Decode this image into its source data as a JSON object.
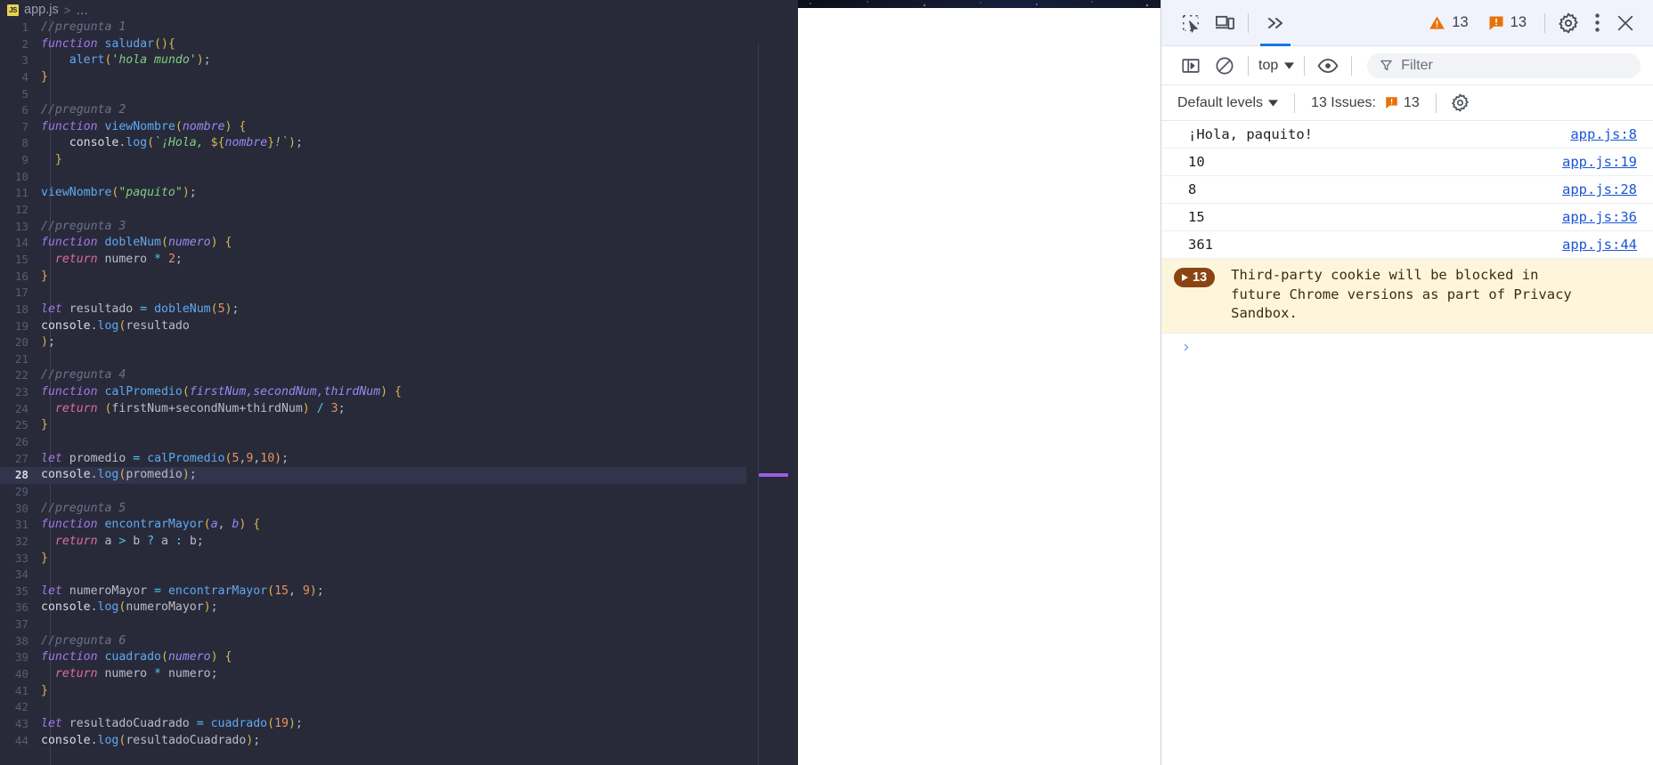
{
  "editor": {
    "breadcrumb": {
      "file_icon": "js-file-icon",
      "filename": "app.js",
      "separator": ">",
      "ellipsis": "…"
    },
    "active_line": 28,
    "lines": [
      {
        "n": 1,
        "tokens": [
          {
            "t": "//pregunta 1",
            "c": "t-com"
          }
        ]
      },
      {
        "n": 2,
        "tokens": [
          {
            "t": "function ",
            "c": "t-kw"
          },
          {
            "t": "saludar",
            "c": "t-fn"
          },
          {
            "t": "(){",
            "c": "t-pun"
          }
        ]
      },
      {
        "n": 3,
        "tokens": [
          {
            "t": "    ",
            "c": "t-pln"
          },
          {
            "t": "alert",
            "c": "t-fn"
          },
          {
            "t": "(",
            "c": "t-pun"
          },
          {
            "t": "'hola mundo'",
            "c": "t-str"
          },
          {
            "t": ")",
            "c": "t-pun"
          },
          {
            "t": ";",
            "c": "t-pln"
          }
        ]
      },
      {
        "n": 4,
        "tokens": [
          {
            "t": "}",
            "c": "t-pun"
          }
        ]
      },
      {
        "n": 5,
        "tokens": []
      },
      {
        "n": 6,
        "tokens": [
          {
            "t": "//pregunta 2",
            "c": "t-com"
          }
        ]
      },
      {
        "n": 7,
        "tokens": [
          {
            "t": "function ",
            "c": "t-kw"
          },
          {
            "t": "viewNombre",
            "c": "t-fn"
          },
          {
            "t": "(",
            "c": "t-pun"
          },
          {
            "t": "nombre",
            "c": "t-par"
          },
          {
            "t": ") {",
            "c": "t-pun"
          }
        ]
      },
      {
        "n": 8,
        "tokens": [
          {
            "t": "    ",
            "c": "t-pln"
          },
          {
            "t": "console",
            "c": "t-obj"
          },
          {
            "t": ".",
            "c": "t-pln"
          },
          {
            "t": "log",
            "c": "t-prop"
          },
          {
            "t": "(",
            "c": "t-pun"
          },
          {
            "t": "`¡Hola, ",
            "c": "t-str"
          },
          {
            "t": "${",
            "c": "t-pun"
          },
          {
            "t": "nombre",
            "c": "t-par"
          },
          {
            "t": "}",
            "c": "t-pun"
          },
          {
            "t": "!`",
            "c": "t-str"
          },
          {
            "t": ")",
            "c": "t-pun"
          },
          {
            "t": ";",
            "c": "t-pln"
          }
        ]
      },
      {
        "n": 9,
        "tokens": [
          {
            "t": "  }",
            "c": "t-pun"
          }
        ]
      },
      {
        "n": 10,
        "tokens": []
      },
      {
        "n": 11,
        "tokens": [
          {
            "t": "viewNombre",
            "c": "t-fn"
          },
          {
            "t": "(",
            "c": "t-pun"
          },
          {
            "t": "\"paquito\"",
            "c": "t-str"
          },
          {
            "t": ")",
            "c": "t-pun"
          },
          {
            "t": ";",
            "c": "t-pln"
          }
        ]
      },
      {
        "n": 12,
        "tokens": []
      },
      {
        "n": 13,
        "tokens": [
          {
            "t": "//pregunta 3",
            "c": "t-com"
          }
        ]
      },
      {
        "n": 14,
        "tokens": [
          {
            "t": "function ",
            "c": "t-kw"
          },
          {
            "t": "dobleNum",
            "c": "t-fn"
          },
          {
            "t": "(",
            "c": "t-pun"
          },
          {
            "t": "numero",
            "c": "t-par"
          },
          {
            "t": ") {",
            "c": "t-pun"
          }
        ]
      },
      {
        "n": 15,
        "tokens": [
          {
            "t": "  ",
            "c": "t-pln"
          },
          {
            "t": "return ",
            "c": "t-kw2"
          },
          {
            "t": "numero ",
            "c": "t-pln"
          },
          {
            "t": "*",
            "c": "t-op"
          },
          {
            "t": " ",
            "c": "t-pln"
          },
          {
            "t": "2",
            "c": "t-num"
          },
          {
            "t": ";",
            "c": "t-pln"
          }
        ]
      },
      {
        "n": 16,
        "tokens": [
          {
            "t": "}",
            "c": "t-pun"
          }
        ]
      },
      {
        "n": 17,
        "tokens": []
      },
      {
        "n": 18,
        "tokens": [
          {
            "t": "let ",
            "c": "t-kw"
          },
          {
            "t": "resultado ",
            "c": "t-pln"
          },
          {
            "t": "=",
            "c": "t-eq"
          },
          {
            "t": " ",
            "c": "t-pln"
          },
          {
            "t": "dobleNum",
            "c": "t-fn"
          },
          {
            "t": "(",
            "c": "t-pun"
          },
          {
            "t": "5",
            "c": "t-num"
          },
          {
            "t": ")",
            "c": "t-pun"
          },
          {
            "t": ";",
            "c": "t-pln"
          }
        ]
      },
      {
        "n": 19,
        "tokens": [
          {
            "t": "console",
            "c": "t-obj"
          },
          {
            "t": ".",
            "c": "t-pln"
          },
          {
            "t": "log",
            "c": "t-prop"
          },
          {
            "t": "(",
            "c": "t-pun"
          },
          {
            "t": "resultado",
            "c": "t-pln"
          }
        ]
      },
      {
        "n": 20,
        "tokens": [
          {
            "t": ")",
            "c": "t-pun"
          },
          {
            "t": ";",
            "c": "t-pln"
          }
        ]
      },
      {
        "n": 21,
        "tokens": []
      },
      {
        "n": 22,
        "tokens": [
          {
            "t": "//pregunta 4",
            "c": "t-com"
          }
        ]
      },
      {
        "n": 23,
        "tokens": [
          {
            "t": "function ",
            "c": "t-kw"
          },
          {
            "t": "calPromedio",
            "c": "t-fn"
          },
          {
            "t": "(",
            "c": "t-pun"
          },
          {
            "t": "firstNum,secondNum,thirdNum",
            "c": "t-par"
          },
          {
            "t": ") {",
            "c": "t-pun"
          }
        ]
      },
      {
        "n": 24,
        "tokens": [
          {
            "t": "  ",
            "c": "t-pln"
          },
          {
            "t": "return ",
            "c": "t-kw2"
          },
          {
            "t": "(",
            "c": "t-pun"
          },
          {
            "t": "firstNum+secondNum+thirdNum",
            "c": "t-pln"
          },
          {
            "t": ")",
            "c": "t-pun"
          },
          {
            "t": " ",
            "c": "t-pln"
          },
          {
            "t": "/",
            "c": "t-op"
          },
          {
            "t": " ",
            "c": "t-pln"
          },
          {
            "t": "3",
            "c": "t-num"
          },
          {
            "t": ";",
            "c": "t-pln"
          }
        ]
      },
      {
        "n": 25,
        "tokens": [
          {
            "t": "}",
            "c": "t-pun"
          }
        ]
      },
      {
        "n": 26,
        "tokens": []
      },
      {
        "n": 27,
        "tokens": [
          {
            "t": "let ",
            "c": "t-kw"
          },
          {
            "t": "promedio ",
            "c": "t-pln"
          },
          {
            "t": "=",
            "c": "t-eq"
          },
          {
            "t": " ",
            "c": "t-pln"
          },
          {
            "t": "calPromedio",
            "c": "t-fn"
          },
          {
            "t": "(",
            "c": "t-pun"
          },
          {
            "t": "5",
            "c": "t-num"
          },
          {
            "t": ",",
            "c": "t-pln"
          },
          {
            "t": "9",
            "c": "t-num"
          },
          {
            "t": ",",
            "c": "t-pln"
          },
          {
            "t": "10",
            "c": "t-num"
          },
          {
            "t": ")",
            "c": "t-pun"
          },
          {
            "t": ";",
            "c": "t-pln"
          }
        ]
      },
      {
        "n": 28,
        "tokens": [
          {
            "t": "console",
            "c": "t-obj"
          },
          {
            "t": ".",
            "c": "t-pln"
          },
          {
            "t": "log",
            "c": "t-prop"
          },
          {
            "t": "(",
            "c": "t-pun"
          },
          {
            "t": "promedio",
            "c": "t-pln"
          },
          {
            "t": ")",
            "c": "t-pun"
          },
          {
            "t": ";",
            "c": "t-pln"
          }
        ]
      },
      {
        "n": 29,
        "tokens": []
      },
      {
        "n": 30,
        "tokens": [
          {
            "t": "//pregunta 5",
            "c": "t-com"
          }
        ]
      },
      {
        "n": 31,
        "tokens": [
          {
            "t": "function ",
            "c": "t-kw"
          },
          {
            "t": "encontrarMayor",
            "c": "t-fn"
          },
          {
            "t": "(",
            "c": "t-pun"
          },
          {
            "t": "a",
            "c": "t-par"
          },
          {
            "t": ", ",
            "c": "t-pln"
          },
          {
            "t": "b",
            "c": "t-par"
          },
          {
            "t": ") {",
            "c": "t-pun"
          }
        ]
      },
      {
        "n": 32,
        "tokens": [
          {
            "t": "  ",
            "c": "t-pln"
          },
          {
            "t": "return ",
            "c": "t-kw2"
          },
          {
            "t": "a ",
            "c": "t-pln"
          },
          {
            "t": ">",
            "c": "t-op"
          },
          {
            "t": " b ",
            "c": "t-pln"
          },
          {
            "t": "?",
            "c": "t-op"
          },
          {
            "t": " a ",
            "c": "t-pln"
          },
          {
            "t": ":",
            "c": "t-op"
          },
          {
            "t": " b;",
            "c": "t-pln"
          }
        ]
      },
      {
        "n": 33,
        "tokens": [
          {
            "t": "}",
            "c": "t-pun"
          }
        ]
      },
      {
        "n": 34,
        "tokens": []
      },
      {
        "n": 35,
        "tokens": [
          {
            "t": "let ",
            "c": "t-kw"
          },
          {
            "t": "numeroMayor ",
            "c": "t-pln"
          },
          {
            "t": "=",
            "c": "t-eq"
          },
          {
            "t": " ",
            "c": "t-pln"
          },
          {
            "t": "encontrarMayor",
            "c": "t-fn"
          },
          {
            "t": "(",
            "c": "t-pun"
          },
          {
            "t": "15",
            "c": "t-num"
          },
          {
            "t": ", ",
            "c": "t-pln"
          },
          {
            "t": "9",
            "c": "t-num"
          },
          {
            "t": ")",
            "c": "t-pun"
          },
          {
            "t": ";",
            "c": "t-pln"
          }
        ]
      },
      {
        "n": 36,
        "tokens": [
          {
            "t": "console",
            "c": "t-obj"
          },
          {
            "t": ".",
            "c": "t-pln"
          },
          {
            "t": "log",
            "c": "t-prop"
          },
          {
            "t": "(",
            "c": "t-pun"
          },
          {
            "t": "numeroMayor",
            "c": "t-pln"
          },
          {
            "t": ")",
            "c": "t-pun"
          },
          {
            "t": ";",
            "c": "t-pln"
          }
        ]
      },
      {
        "n": 37,
        "tokens": []
      },
      {
        "n": 38,
        "tokens": [
          {
            "t": "//pregunta 6",
            "c": "t-com"
          }
        ]
      },
      {
        "n": 39,
        "tokens": [
          {
            "t": "function ",
            "c": "t-kw"
          },
          {
            "t": "cuadrado",
            "c": "t-fn"
          },
          {
            "t": "(",
            "c": "t-pun"
          },
          {
            "t": "numero",
            "c": "t-par"
          },
          {
            "t": ") {",
            "c": "t-pun"
          }
        ]
      },
      {
        "n": 40,
        "tokens": [
          {
            "t": "  ",
            "c": "t-pln"
          },
          {
            "t": "return ",
            "c": "t-kw2"
          },
          {
            "t": "numero ",
            "c": "t-pln"
          },
          {
            "t": "*",
            "c": "t-op"
          },
          {
            "t": " numero;",
            "c": "t-pln"
          }
        ]
      },
      {
        "n": 41,
        "tokens": [
          {
            "t": "}",
            "c": "t-pun"
          }
        ]
      },
      {
        "n": 42,
        "tokens": []
      },
      {
        "n": 43,
        "tokens": [
          {
            "t": "let ",
            "c": "t-kw"
          },
          {
            "t": "resultadoCuadrado ",
            "c": "t-pln"
          },
          {
            "t": "=",
            "c": "t-eq"
          },
          {
            "t": " ",
            "c": "t-pln"
          },
          {
            "t": "cuadrado",
            "c": "t-fn"
          },
          {
            "t": "(",
            "c": "t-pun"
          },
          {
            "t": "19",
            "c": "t-num"
          },
          {
            "t": ")",
            "c": "t-pun"
          },
          {
            "t": ";",
            "c": "t-pln"
          }
        ]
      },
      {
        "n": 44,
        "tokens": [
          {
            "t": "console",
            "c": "t-obj"
          },
          {
            "t": ".",
            "c": "t-pln"
          },
          {
            "t": "log",
            "c": "t-prop"
          },
          {
            "t": "(",
            "c": "t-pun"
          },
          {
            "t": "resultadoCuadrado",
            "c": "t-pln"
          },
          {
            "t": ")",
            "c": "t-pun"
          },
          {
            "t": ";",
            "c": "t-pln"
          }
        ]
      }
    ]
  },
  "devtools": {
    "toolbar": {
      "inspect_icon": "inspect-element-icon",
      "device_icon": "device-toolbar-icon",
      "more_tabs_icon": "more-tabs-chevrons",
      "warnings_count": "13",
      "issues_count": "13",
      "settings_icon": "gear-icon",
      "kebab_icon": "more-options-icon",
      "close_icon": "close-icon"
    },
    "console_toolbar": {
      "sidebar_icon": "console-sidebar-icon",
      "clear_icon": "clear-console-icon",
      "context": "top",
      "eye_icon": "live-expressions-eye-icon",
      "filter_icon": "filter-funnel-icon",
      "filter_placeholder": "Filter",
      "filter_value": ""
    },
    "levels_row": {
      "levels_label": "Default levels",
      "issues_label": "13 Issues:",
      "issues_count": "13",
      "issues_settings_icon": "gear-icon"
    },
    "logs": [
      {
        "message": "¡Hola, paquito!",
        "source": "app.js:8"
      },
      {
        "message": "10",
        "source": "app.js:19"
      },
      {
        "message": "8",
        "source": "app.js:28"
      },
      {
        "message": "15",
        "source": "app.js:36"
      },
      {
        "message": "361",
        "source": "app.js:44"
      }
    ],
    "warning": {
      "count": "13",
      "expand_icon": "expand-triangle-icon",
      "text": "Third-party cookie will be blocked in future Chrome versions as part of Privacy Sandbox."
    },
    "prompt": {
      "chevron": "›"
    }
  },
  "colors": {
    "editor_bg": "#282a3a",
    "devtools_toolbar_bg": "#f0f3fb",
    "accent_blue": "#1a73e8",
    "warning_orange": "#e8710a",
    "link_blue": "#1a56d6",
    "warn_bg": "#fdf6dd",
    "warn_badge": "#8a4512"
  }
}
